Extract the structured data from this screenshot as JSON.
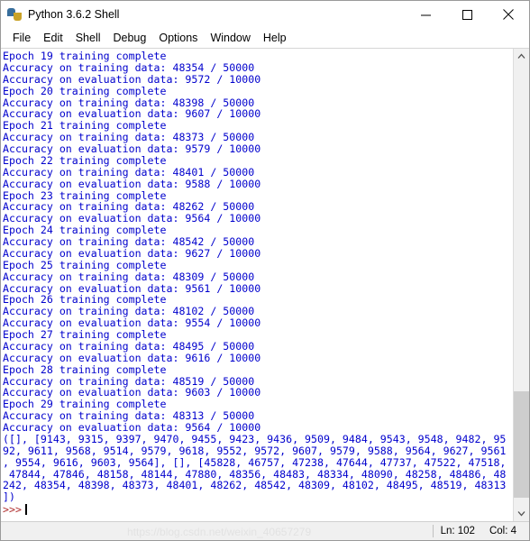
{
  "window": {
    "title": "Python 3.6.2 Shell",
    "icon": "python-logo-icon",
    "minimize_label": "minimize-icon",
    "maximize_label": "maximize-icon",
    "close_label": "close-icon"
  },
  "menubar": {
    "items": [
      {
        "label": "File"
      },
      {
        "label": "Edit"
      },
      {
        "label": "Shell"
      },
      {
        "label": "Debug"
      },
      {
        "label": "Options"
      },
      {
        "label": "Window"
      },
      {
        "label": "Help"
      }
    ]
  },
  "console": {
    "text_color": "#0000cd",
    "prompt_color": "#b03030",
    "lines": [
      "Epoch 19 training complete",
      "Accuracy on training data: 48354 / 50000",
      "Accuracy on evaluation data: 9572 / 10000",
      "Epoch 20 training complete",
      "Accuracy on training data: 48398 / 50000",
      "Accuracy on evaluation data: 9607 / 10000",
      "Epoch 21 training complete",
      "Accuracy on training data: 48373 / 50000",
      "Accuracy on evaluation data: 9579 / 10000",
      "Epoch 22 training complete",
      "Accuracy on training data: 48401 / 50000",
      "Accuracy on evaluation data: 9588 / 10000",
      "Epoch 23 training complete",
      "Accuracy on training data: 48262 / 50000",
      "Accuracy on evaluation data: 9564 / 10000",
      "Epoch 24 training complete",
      "Accuracy on training data: 48542 / 50000",
      "Accuracy on evaluation data: 9627 / 10000",
      "Epoch 25 training complete",
      "Accuracy on training data: 48309 / 50000",
      "Accuracy on evaluation data: 9561 / 10000",
      "Epoch 26 training complete",
      "Accuracy on training data: 48102 / 50000",
      "Accuracy on evaluation data: 9554 / 10000",
      "Epoch 27 training complete",
      "Accuracy on training data: 48495 / 50000",
      "Accuracy on evaluation data: 9616 / 10000",
      "Epoch 28 training complete",
      "Accuracy on training data: 48519 / 50000",
      "Accuracy on evaluation data: 9603 / 10000",
      "Epoch 29 training complete",
      "Accuracy on training data: 48313 / 50000",
      "Accuracy on evaluation data: 9564 / 10000",
      "([], [9143, 9315, 9397, 9470, 9455, 9423, 9436, 9509, 9484, 9543, 9548, 9482, 95",
      "92, 9611, 9568, 9514, 9579, 9618, 9552, 9572, 9607, 9579, 9588, 9564, 9627, 9561",
      ", 9554, 9616, 9603, 9564], [], [45828, 46757, 47238, 47644, 47737, 47522, 47518,",
      " 47844, 47846, 48158, 48144, 47880, 48356, 48483, 48334, 48090, 48258, 48486, 48",
      "242, 48354, 48398, 48373, 48401, 48262, 48542, 48309, 48102, 48495, 48519, 48313",
      "])"
    ],
    "prompt": ">>>"
  },
  "scrollbar": {
    "up_arrow": "chevron-up-icon",
    "down_arrow": "chevron-down-icon"
  },
  "statusbar": {
    "line_label": "Ln: 102",
    "col_label": "Col: 4"
  },
  "watermark": {
    "text": "https://blog.csdn.net/weixin_40657279"
  }
}
